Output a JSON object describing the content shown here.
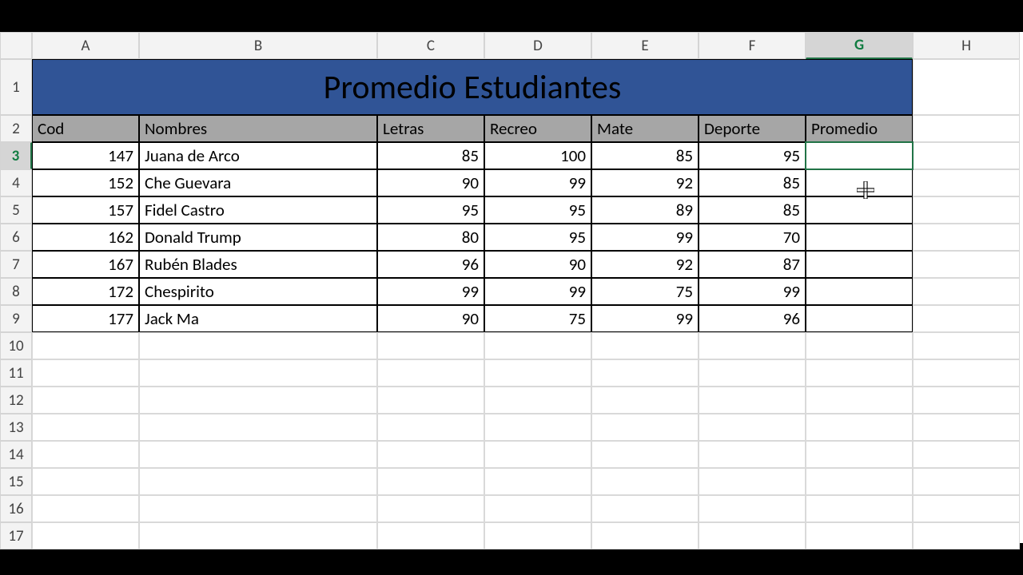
{
  "columns": [
    "A",
    "B",
    "C",
    "D",
    "E",
    "F",
    "G",
    "H"
  ],
  "row_numbers": [
    1,
    2,
    3,
    4,
    5,
    6,
    7,
    8,
    9,
    10,
    11,
    12,
    13,
    14,
    15,
    16,
    17
  ],
  "selected_column": "G",
  "selected_row": 3,
  "title": "Promedio Estudiantes",
  "headers": {
    "cod": "Cod",
    "nombres": "Nombres",
    "letras": "Letras",
    "recreo": "Recreo",
    "mate": "Mate",
    "deporte": "Deporte",
    "promedio": "Promedio"
  },
  "rows": [
    {
      "cod": 147,
      "nombres": "Juana de Arco",
      "letras": 85,
      "recreo": 100,
      "mate": 85,
      "deporte": 95,
      "promedio": ""
    },
    {
      "cod": 152,
      "nombres": "Che Guevara",
      "letras": 90,
      "recreo": 99,
      "mate": 92,
      "deporte": 85,
      "promedio": ""
    },
    {
      "cod": 157,
      "nombres": "Fidel Castro",
      "letras": 95,
      "recreo": 95,
      "mate": 89,
      "deporte": 85,
      "promedio": ""
    },
    {
      "cod": 162,
      "nombres": "Donald Trump",
      "letras": 80,
      "recreo": 95,
      "mate": 99,
      "deporte": 70,
      "promedio": ""
    },
    {
      "cod": 167,
      "nombres": "Rubén Blades",
      "letras": 96,
      "recreo": 90,
      "mate": 92,
      "deporte": 87,
      "promedio": ""
    },
    {
      "cod": 172,
      "nombres": "Chespirito",
      "letras": 99,
      "recreo": 99,
      "mate": 75,
      "deporte": 99,
      "promedio": ""
    },
    {
      "cod": 177,
      "nombres": "Jack Ma",
      "letras": 90,
      "recreo": 75,
      "mate": 99,
      "deporte": 96,
      "promedio": ""
    }
  ]
}
